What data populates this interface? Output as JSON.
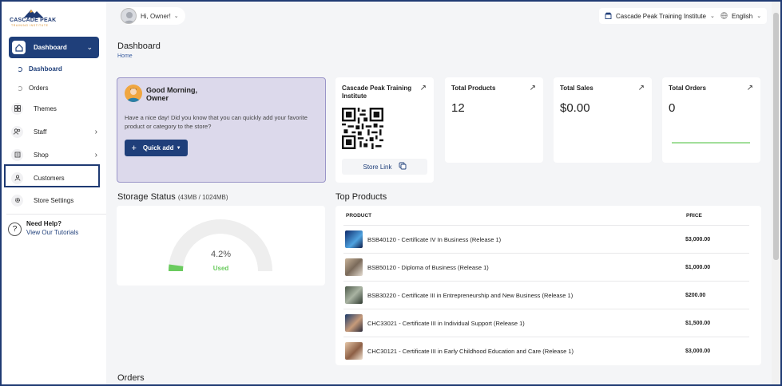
{
  "brand": {
    "name": "CASCADE PEAK",
    "sub": "TRAINING INSTITUTE"
  },
  "sidebar": {
    "dashboard_label": "Dashboard",
    "sub_items": [
      {
        "label": "Dashboard",
        "active": true
      },
      {
        "label": "Orders",
        "active": false
      }
    ],
    "items": [
      {
        "label": "Themes",
        "icon": "themes-icon"
      },
      {
        "label": "Staff",
        "icon": "staff-icon"
      },
      {
        "label": "Shop",
        "icon": "shop-icon"
      },
      {
        "label": "Customers",
        "icon": "customer-icon"
      },
      {
        "label": "Store Settings",
        "icon": "gear-icon"
      }
    ],
    "help_title": "Need Help?",
    "help_link": "View Our Tutorials"
  },
  "topbar": {
    "greeting": "Hi, Owner!",
    "store": "Cascade Peak Training Institute",
    "language": "English"
  },
  "page": {
    "title": "Dashboard",
    "breadcrumb": "Home"
  },
  "welcome": {
    "line1": "Good Morning,",
    "line2": "Owner",
    "text": "Have a nice day! Did you know that you can quickly add your favorite product or category to the store?",
    "button": "Quick add"
  },
  "qr_card": {
    "title": "Cascade Peak Training Institute",
    "link_label": "Store Link"
  },
  "stats": [
    {
      "title": "Total Products",
      "value": "12"
    },
    {
      "title": "Total Sales",
      "value": "$0.00"
    },
    {
      "title": "Total Orders",
      "value": "0"
    }
  ],
  "storage": {
    "title": "Storage Status",
    "detail": "(43MB / 1024MB)",
    "percent_label": "4.2%",
    "used_label": "Used",
    "used_fraction": 0.042,
    "color_used": "#6acb5e",
    "color_track": "#eeeeee"
  },
  "top_products": {
    "title": "Top Products",
    "col_product": "PRODUCT",
    "col_price": "PRICE",
    "rows": [
      {
        "name": "BSB40120 - Certificate IV In Business (Release 1)",
        "price": "$3,000.00"
      },
      {
        "name": "BSB50120 - Diploma of Business (Release 1)",
        "price": "$1,000.00"
      },
      {
        "name": "BSB30220 - Certificate III in Entrepreneurship and New Business (Release 1)",
        "price": "$200.00"
      },
      {
        "name": "CHC33021 - Certificate III in Individual Support (Release 1)",
        "price": "$1,500.00"
      },
      {
        "name": "CHC30121 - Certificate III in Early Childhood Education and Care (Release 1)",
        "price": "$3,000.00"
      }
    ]
  },
  "orders_section": {
    "title": "Orders"
  },
  "colors": {
    "primary": "#1f3f7a",
    "welcome_bg": "#dcd9eb",
    "accent_green": "#6acb5e"
  }
}
